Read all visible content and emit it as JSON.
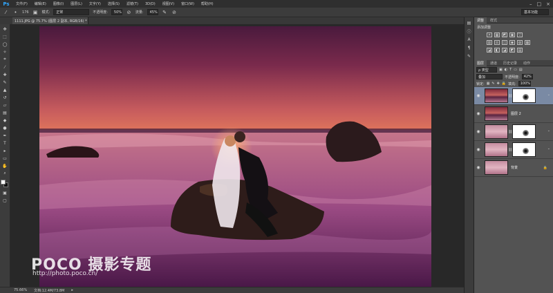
{
  "app": {
    "logo": "Ps",
    "menu": [
      "文件(F)",
      "编辑(E)",
      "图像(I)",
      "图层(L)",
      "文字(Y)",
      "选择(S)",
      "滤镜(T)",
      "3D(D)",
      "视图(V)",
      "窗口(W)",
      "帮助(H)"
    ],
    "window_controls": [
      "–",
      "□",
      "×"
    ]
  },
  "options_bar": {
    "brush_size": "176",
    "mode_label": "模式:",
    "mode_value": "正常",
    "opacity_label": "不透明度:",
    "opacity_value": "50%",
    "flow_label": "流量:",
    "flow_value": "45%",
    "workspace": "基本功能"
  },
  "document_tab": {
    "title": "1111.JPG @ 75.7% (图层 2 副本, RGB/16) *",
    "close": "×"
  },
  "status_bar": {
    "zoom": "75.66%",
    "doc_info": "文档:12.4M/73.8M"
  },
  "watermark": {
    "logo_text": "POCO 摄影专题",
    "url": "http://photo.poco.cn/"
  },
  "adjustments_panel": {
    "tabs": [
      "调整",
      "样式"
    ],
    "active_tab": "调整",
    "title": "添加调整",
    "row1": [
      "☀",
      "▦",
      "◩",
      "▣",
      "▽"
    ],
    "row2": [
      "▥",
      "⚖",
      "◫",
      "◉",
      "◍",
      "▦"
    ],
    "row3": [
      "◪",
      "◧",
      "◪",
      "◩",
      "▤"
    ]
  },
  "layers_panel": {
    "tabs": [
      "图层",
      "通道",
      "历史记录",
      "动作"
    ],
    "active_tab": "图层",
    "kind_label": "ρ 类型",
    "blend_mode": "叠加",
    "opacity_label": "不透明度:",
    "opacity_value": "42%",
    "lock_label": "锁定:",
    "fill_label": "填充:",
    "fill_value": "100%",
    "layers": [
      {
        "name": "",
        "has_mask": true,
        "selected": true
      },
      {
        "name": "图层 2",
        "has_mask": false,
        "selected": false
      },
      {
        "name": "",
        "has_mask": true,
        "selected": false
      },
      {
        "name": "",
        "has_mask": true,
        "selected": false
      },
      {
        "name": "背景",
        "has_mask": false,
        "selected": false,
        "locked": true
      }
    ]
  }
}
